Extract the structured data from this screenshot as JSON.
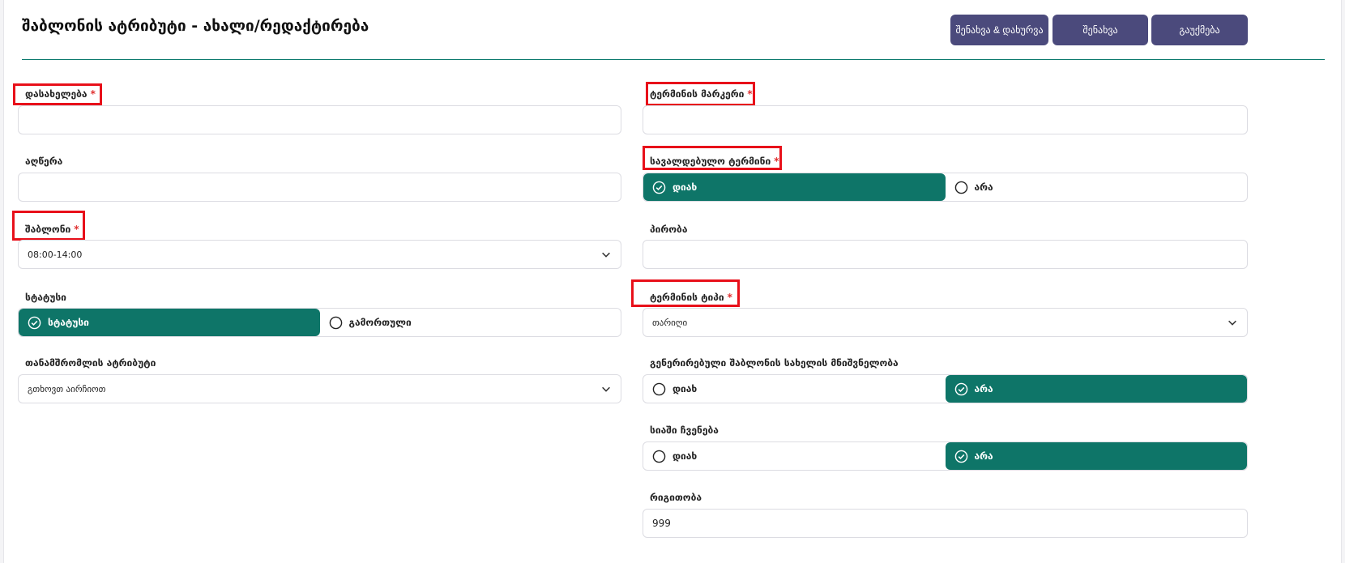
{
  "page": {
    "title": "შაბლონის ატრიბუტი - ახალი/რედაქტირება"
  },
  "toolbar": {
    "save_close_label": "შენახვა & დახურვა",
    "save_label": "შენახვა",
    "cancel_label": "გაუქმება"
  },
  "left": {
    "name": {
      "label": "დასახელება",
      "value": ""
    },
    "description": {
      "label": "აღწერა",
      "value": ""
    },
    "template": {
      "label": "შაბლონი",
      "value": "08:00-14:00"
    },
    "status": {
      "label": "სტატუსი",
      "options": [
        "სტატუსი",
        "გამორთული"
      ],
      "selected": "სტატუსი"
    },
    "employee_attribute": {
      "label": "თანამშრომლის ატრიბუტი",
      "value": "გთხოვთ აირჩიოთ"
    }
  },
  "right": {
    "term_marker": {
      "label": "ტერმინის მარკერი",
      "value": ""
    },
    "required_term": {
      "label": "სავალდებულო ტერმინი",
      "options": [
        "დიახ",
        "არა"
      ],
      "selected": "დიახ"
    },
    "condition": {
      "label": "პირობა",
      "value": ""
    },
    "term_type": {
      "label": "ტერმინის ტიპი",
      "value": "თარიღი"
    },
    "generated_name_value": {
      "label": "გენერირებული შაბლონის სახელის მნიშვნელობა",
      "options": [
        "დიახ",
        "არა"
      ],
      "selected": "არა"
    },
    "show_in_list": {
      "label": "სიაში ჩვენება",
      "options": [
        "დიახ",
        "არა"
      ],
      "selected": "არა"
    },
    "order": {
      "label": "რიგითობა",
      "value": "999"
    }
  },
  "required_mark": "*",
  "colors": {
    "accent": "#0e7568",
    "button": "#4b4a7c",
    "required": "#e03030",
    "highlight": "#e8101a"
  },
  "icons": {
    "checked": "check-circle-icon",
    "unchecked": "radio-empty-icon",
    "dropdown": "chevron-down-icon"
  }
}
